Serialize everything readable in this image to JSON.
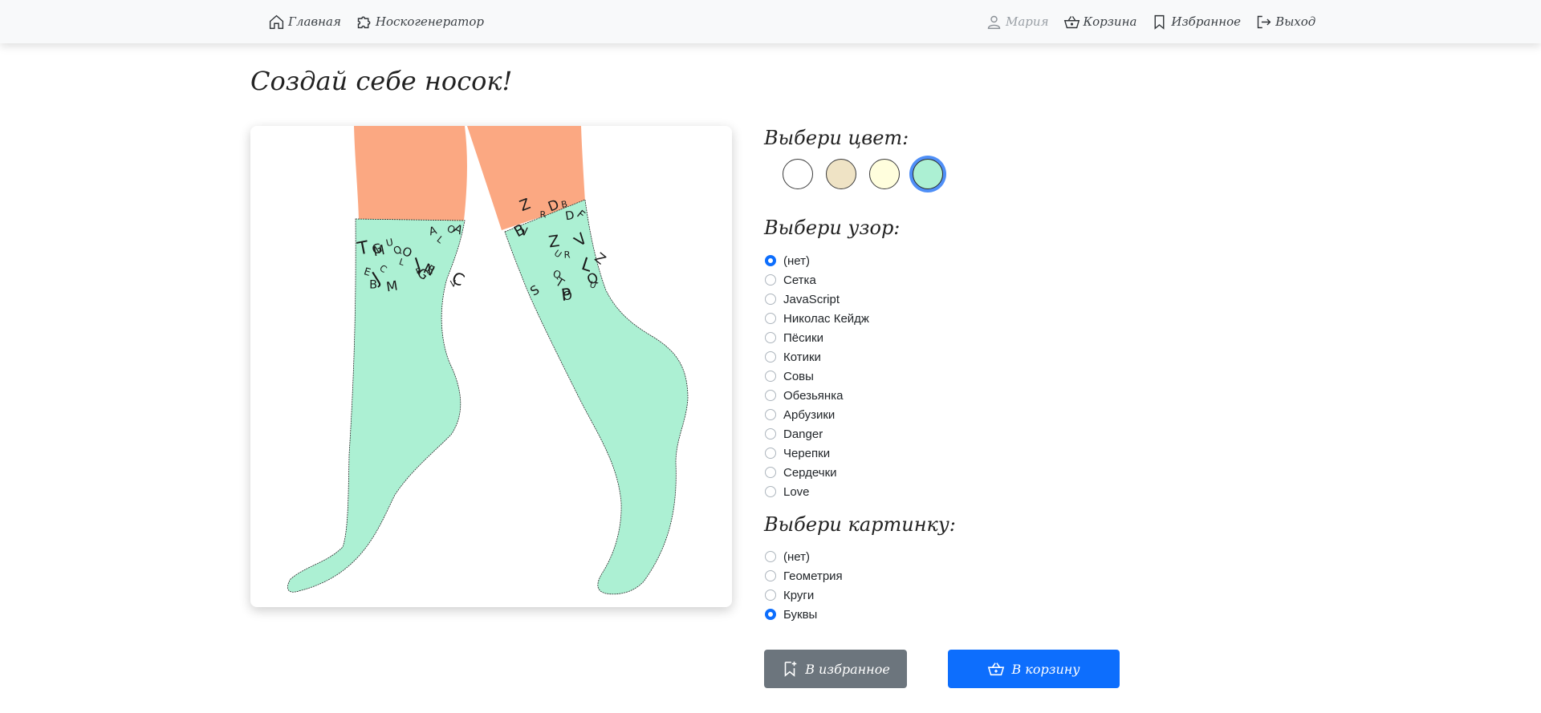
{
  "nav": {
    "home": "Главная",
    "generator": "Носкогенератор",
    "user": "Мария",
    "cart": "Корзина",
    "favorites": "Избранное",
    "logout": "Выход"
  },
  "page": {
    "title": "Создай себе носок!"
  },
  "color_section": {
    "title": "Выбери цвет:",
    "swatches": [
      "#ffffff",
      "#efe3c5",
      "#fffedd",
      "#acf0d3"
    ],
    "selected": "#acf0d3"
  },
  "pattern_section": {
    "title": "Выбери узор:",
    "options": [
      "(нет)",
      "Сетка",
      "JavaScript",
      "Николас Кейдж",
      "Пёсики",
      "Котики",
      "Совы",
      "Обезьянка",
      "Арбузики",
      "Danger",
      "Черепки",
      "Сердечки",
      "Love"
    ],
    "selected": "(нет)"
  },
  "picture_section": {
    "title": "Выбери картинку:",
    "options": [
      "(нет)",
      "Геометрия",
      "Круги",
      "Буквы"
    ],
    "selected": "Буквы"
  },
  "buttons": {
    "favorite": "В избранное",
    "cart": "В корзину"
  },
  "colors": {
    "skin": "#fba882",
    "sock": "#acf0d3",
    "primary": "#0d6efd",
    "secondary": "#6c757d"
  },
  "sock_letters": {
    "left": [
      "V",
      "B",
      "C",
      "G",
      "A",
      "O",
      "M",
      "F",
      "T",
      "J",
      "O",
      "Q",
      "E",
      "C",
      "G",
      "U",
      "R",
      "M",
      "A",
      "L",
      "J",
      "N",
      "L"
    ],
    "right": [
      "B",
      "O",
      "R",
      "Z",
      "D",
      "U",
      "V",
      "Z",
      "V",
      "Q",
      "R",
      "P",
      "B",
      "Z",
      "U",
      "Q",
      "D",
      "L",
      "T",
      "S",
      "F"
    ]
  }
}
